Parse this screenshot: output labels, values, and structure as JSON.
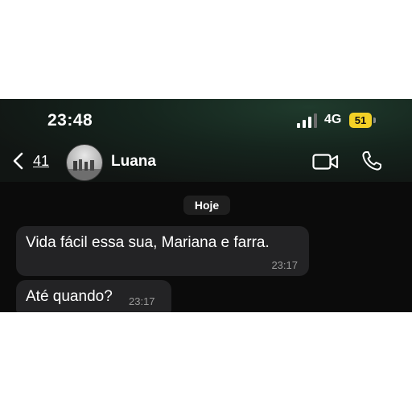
{
  "status_bar": {
    "time": "23:48",
    "network": "4G",
    "battery": "51",
    "battery_color": "#f3d126"
  },
  "header": {
    "back_count": "41",
    "contact_name": "Luana",
    "icons": [
      "chevron-left-icon",
      "video-call-icon",
      "phone-call-icon"
    ]
  },
  "chat": {
    "date_label": "Hoje",
    "messages": [
      {
        "text": "Vida fácil essa sua, Mariana e farra.",
        "time": "23:17"
      },
      {
        "text": "Até quando?",
        "time": "23:17"
      }
    ]
  }
}
